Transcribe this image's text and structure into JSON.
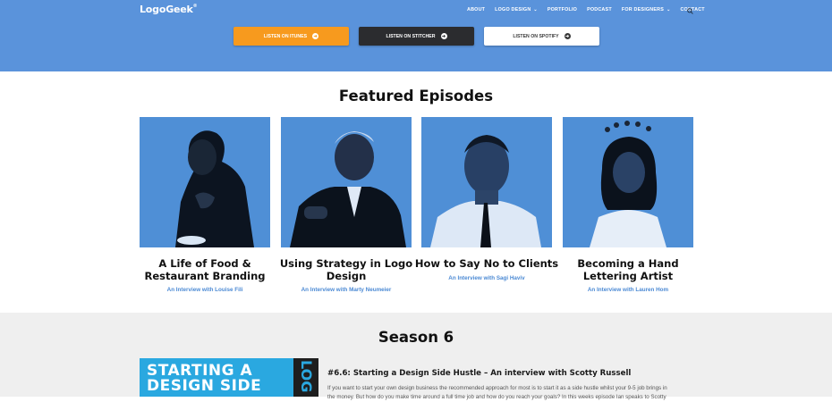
{
  "header": {
    "logo_text_a": "Logo",
    "logo_text_b": "Geek",
    "logo_tm": "®",
    "nav": [
      "ABOUT",
      "LOGO DESIGN",
      "PORTFOLIO",
      "PODCAST",
      "FOR DESIGNERS",
      "CONTACT"
    ],
    "nav_dropdown": [
      "LOGO DESIGN",
      "FOR DESIGNERS"
    ]
  },
  "listen_buttons": [
    {
      "label": "LISTEN ON ITUNES"
    },
    {
      "label": "LISTEN ON STITCHER"
    },
    {
      "label": "LISTEN ON SPOTIFY"
    }
  ],
  "featured": {
    "title": "Featured Episodes",
    "episodes": [
      {
        "title_line1": "A Life of Food &",
        "title_line2": "Restaurant Branding",
        "subtitle": "An Interview with Louise Fili"
      },
      {
        "title_line1": "Using Strategy in Logo",
        "title_line2": "Design",
        "subtitle": "An Interview with Marty Neumeier"
      },
      {
        "title_line1": "How to Say No to Clients",
        "title_line2": "",
        "subtitle": "An Interview with Sagi Haviv"
      },
      {
        "title_line1": "Becoming a Hand",
        "title_line2": "Lettering Artist",
        "subtitle": "An Interview with Lauren Hom"
      }
    ]
  },
  "season": {
    "title": "Season 6",
    "thumb_text_line1": "STARTING A",
    "thumb_text_line2": "DESIGN SIDE",
    "thumb_strip_text": "LOG",
    "episode_title": "#6.6: Starting a Design Side Hustle – An interview with Scotty Russell",
    "episode_desc_line1": "If you want to start your own design business the recommended approach for most is to start it as a side hustle whilst your 9-5 job brings in",
    "episode_desc_line2": "the money. But how do you make time around a full time job and how do you reach your goals? In this weeks episode Ian speaks to Scotty"
  },
  "colors": {
    "hero_blue": "#5a93db",
    "itunes_orange": "#f79a1e",
    "stitcher_dark": "#2b2c2f",
    "subtitle_blue": "#4c8ad4"
  }
}
